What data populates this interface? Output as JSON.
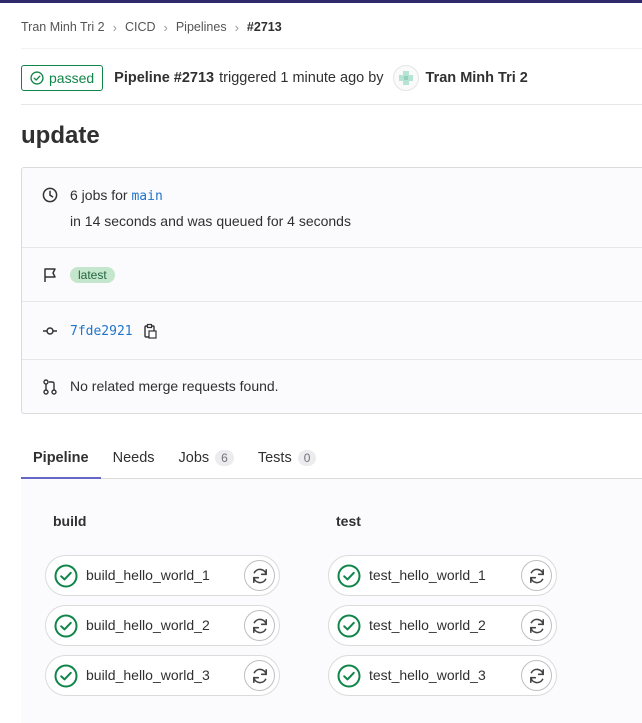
{
  "breadcrumb": {
    "items": [
      "Tran Minh Tri 2",
      "CICD",
      "Pipelines"
    ],
    "current": "#2713"
  },
  "header": {
    "status": "passed",
    "pipeline_title": "Pipeline #2713",
    "meta": "triggered 1 minute ago by",
    "author": "Tran Minh Tri 2"
  },
  "title": "update",
  "info": {
    "jobs_prefix": "6 jobs for",
    "branch": "main",
    "duration": "in 14 seconds and was queued for 4 seconds",
    "tag": "latest",
    "commit": "7fde2921",
    "merge_requests": "No related merge requests found."
  },
  "tabs": [
    {
      "label": "Pipeline",
      "count": null
    },
    {
      "label": "Needs",
      "count": null
    },
    {
      "label": "Jobs",
      "count": "6"
    },
    {
      "label": "Tests",
      "count": "0"
    }
  ],
  "stages": [
    {
      "name": "build",
      "jobs": [
        "build_hello_world_1",
        "build_hello_world_2",
        "build_hello_world_3"
      ]
    },
    {
      "name": "test",
      "jobs": [
        "test_hello_world_1",
        "test_hello_world_2",
        "test_hello_world_3"
      ]
    }
  ],
  "colors": {
    "success": "#108548",
    "link": "#1f75cb",
    "tab_active": "#6666c4"
  }
}
